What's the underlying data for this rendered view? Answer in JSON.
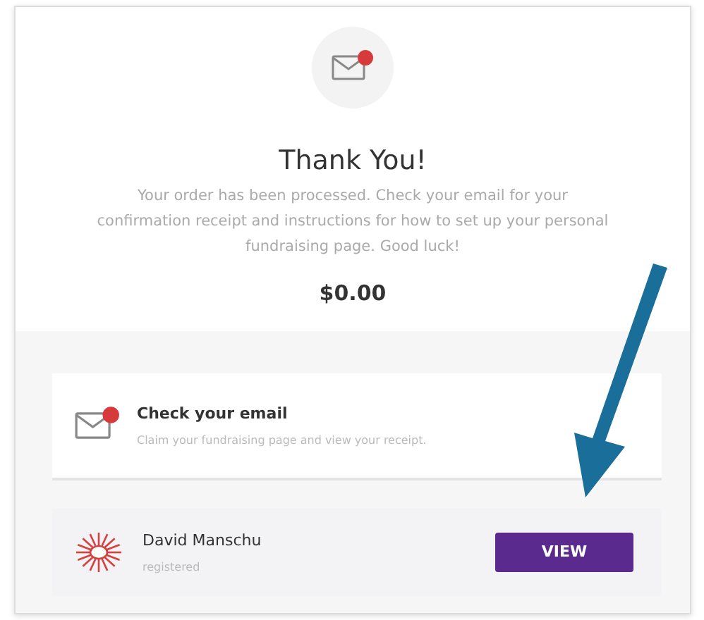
{
  "header": {
    "title": "Thank You!",
    "message": "Your order has been processed. Check your email for your confirmation receipt and instructions for how to set up your personal fundraising page. Good luck!",
    "amount": "$0.00"
  },
  "email_card": {
    "title": "Check your email",
    "subtitle": "Claim your fundraising page and view your receipt."
  },
  "registrant": {
    "name": "David Manschu",
    "status": "registered",
    "button": "VIEW"
  }
}
